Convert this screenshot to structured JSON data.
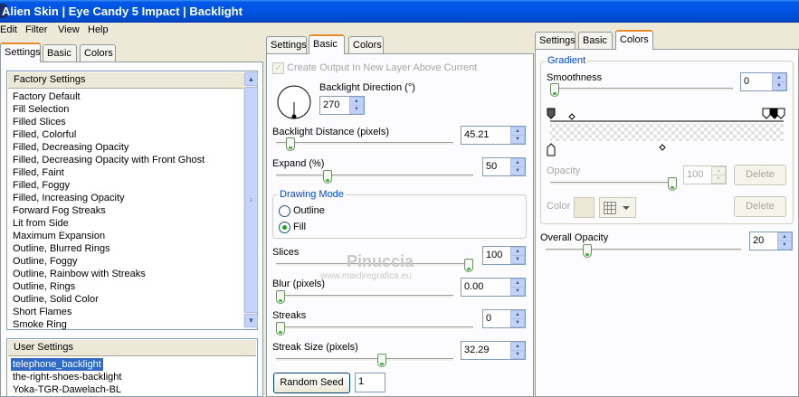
{
  "window": {
    "title": "Alien Skin  |  Eye Candy 5 Impact  |  Backlight"
  },
  "menu": [
    "Edit",
    "Filter",
    "View",
    "Help"
  ],
  "left_panel": {
    "tabs": [
      "Settings",
      "Basic",
      "Colors"
    ],
    "factory_header": "Factory Settings",
    "factory_items": [
      "Factory Default",
      "Fill Selection",
      "Filled Slices",
      "Filled, Colorful",
      "Filled, Decreasing Opacity",
      "Filled, Decreasing Opacity with Front Ghost",
      "Filled, Faint",
      "Filled, Foggy",
      "Filled, Increasing Opacity",
      "Forward Fog Streaks",
      "Lit from Side",
      "Maximum Expansion",
      "Outline, Blurred Rings",
      "Outline, Foggy",
      "Outline, Rainbow with Streaks",
      "Outline, Rings",
      "Outline, Solid Color",
      "Short Flames",
      "Smoke Ring"
    ],
    "user_header": "User Settings",
    "user_items": [
      "telephone_backlight",
      "the-right-shoes-backlight",
      "Yoka-TGR-Dawelach-BL"
    ],
    "user_selected_index": 0
  },
  "basic_panel": {
    "tabs": [
      "Settings",
      "Basic",
      "Colors"
    ],
    "create_output_label": "Create Output In New Layer Above Current",
    "create_output_checked": true,
    "backlight_direction": {
      "label": "Backlight Direction (°)",
      "value": "270"
    },
    "backlight_distance": {
      "label": "Backlight Distance (pixels)",
      "value": "45.21",
      "fraction": 0.06
    },
    "expand": {
      "label": "Expand (%)",
      "value": "50",
      "fraction": 0.25
    },
    "drawing_mode": {
      "title": "Drawing Mode",
      "options": [
        "Outline",
        "Fill"
      ],
      "selected": "Fill"
    },
    "slices": {
      "label": "Slices",
      "value": "100",
      "fraction": 1.0
    },
    "blur": {
      "label": "Blur (pixels)",
      "value": "0.00",
      "fraction": 0.0
    },
    "streaks": {
      "label": "Streaks",
      "value": "0",
      "fraction": 0.0
    },
    "streak_size": {
      "label": "Streak Size (pixels)",
      "value": "32.29",
      "fraction": 0.6
    },
    "random_seed": {
      "label": "Random Seed",
      "value": "1"
    }
  },
  "colors_panel": {
    "tabs": [
      "Settings",
      "Basic",
      "Colors"
    ],
    "gradient_title": "Gradient",
    "smoothness": {
      "label": "Smoothness",
      "value": "0",
      "fraction": 0.0
    },
    "opacity": {
      "label": "Opacity",
      "value": "100",
      "fraction": 1.0
    },
    "delete_label": "Delete",
    "color_label": "Color",
    "overall_opacity": {
      "label": "Overall Opacity",
      "value": "20",
      "fraction": 0.2
    }
  },
  "watermark": {
    "name": "Pinuccia",
    "site": "www.maidiregrafica.eu"
  },
  "colors": {
    "title_bar": "#0054e3",
    "tab_highlight": "#e68b2c",
    "selection": "#316ac5",
    "accent_text": "#0046d5"
  }
}
